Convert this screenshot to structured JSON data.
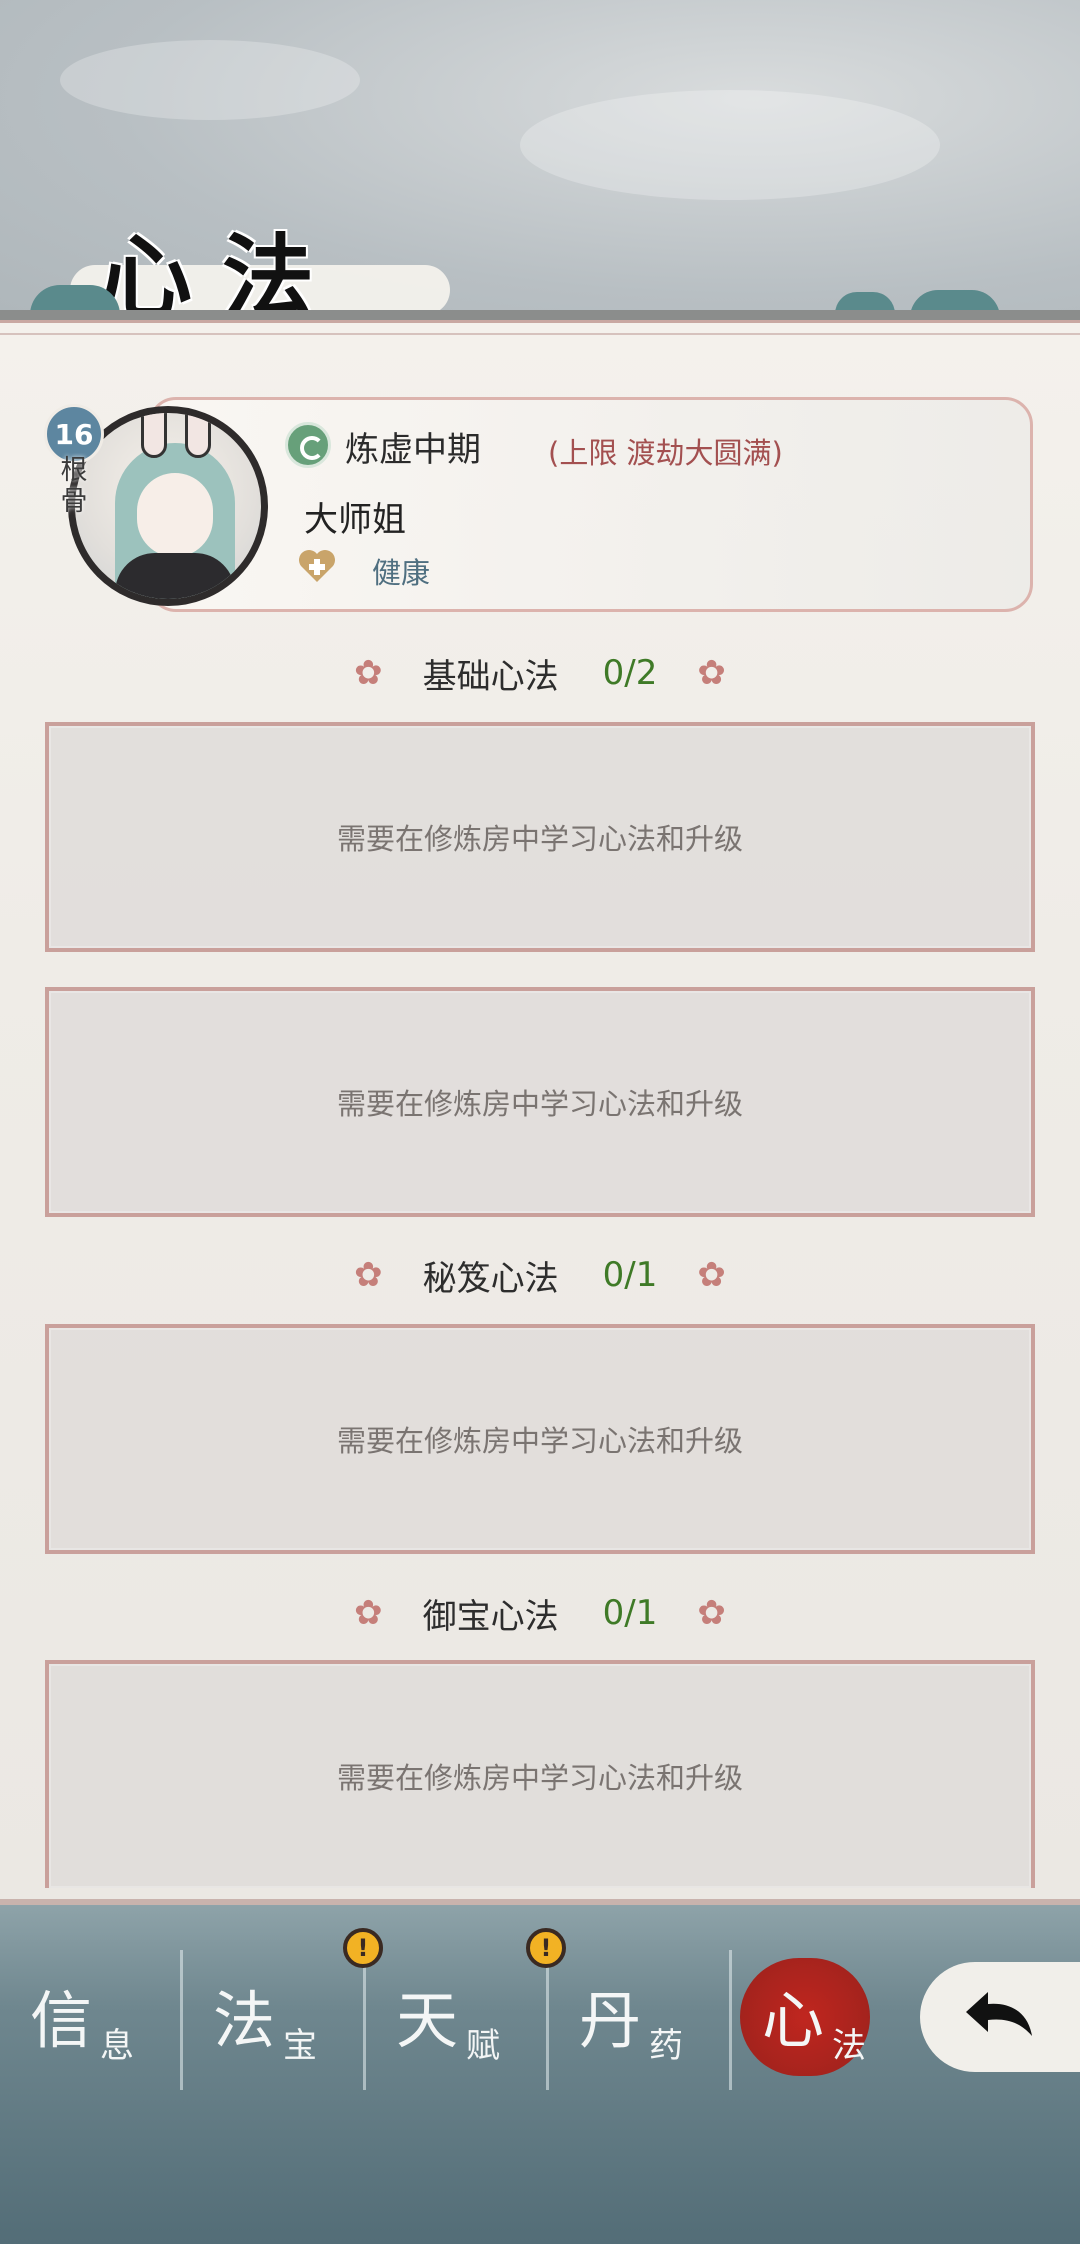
{
  "header": {
    "title_chars": [
      "心",
      "法"
    ]
  },
  "profile": {
    "root_bone_value": "16",
    "root_bone_label": "根骨",
    "realm": "炼虚中期",
    "realm_limit": "(上限 渡劫大圆满)",
    "name": "大师姐",
    "health": "健康"
  },
  "sections": [
    {
      "title": "基础心法",
      "count": "0/2",
      "slots": [
        "需要在修炼房中学习心法和升级",
        "需要在修炼房中学习心法和升级"
      ]
    },
    {
      "title": "秘笈心法",
      "count": "0/1",
      "slots": [
        "需要在修炼房中学习心法和升级"
      ]
    },
    {
      "title": "御宝心法",
      "count": "0/1",
      "slots": [
        "需要在修炼房中学习心法和升级"
      ]
    }
  ],
  "nav": [
    {
      "big": "信",
      "small": "息",
      "alert": false,
      "active": false
    },
    {
      "big": "法",
      "small": "宝",
      "alert": true,
      "active": false
    },
    {
      "big": "天",
      "small": "赋",
      "alert": true,
      "active": false
    },
    {
      "big": "丹",
      "small": "药",
      "alert": false,
      "active": false
    },
    {
      "big": "心",
      "small": "法",
      "alert": false,
      "active": true
    }
  ],
  "alert_symbol": "!",
  "flower_symbol": "✿",
  "colors": {
    "accent_red": "#a5231d",
    "count_green": "#3f7a27",
    "slot_border": "#c9a09b",
    "badge_blue": "#5d86a0"
  }
}
